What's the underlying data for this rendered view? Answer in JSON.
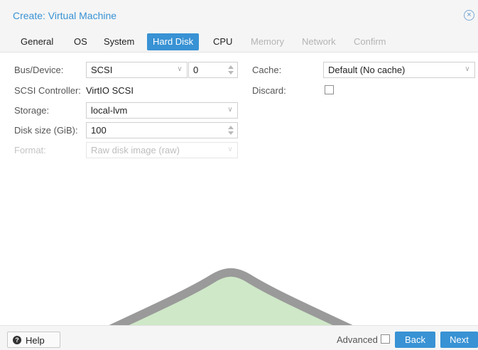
{
  "window": {
    "title": "Create: Virtual Machine",
    "close_glyph": "×"
  },
  "tabs": [
    {
      "label": "General",
      "state": "enabled"
    },
    {
      "label": "OS",
      "state": "enabled"
    },
    {
      "label": "System",
      "state": "enabled"
    },
    {
      "label": "Hard Disk",
      "state": "active"
    },
    {
      "label": "CPU",
      "state": "enabled"
    },
    {
      "label": "Memory",
      "state": "disabled"
    },
    {
      "label": "Network",
      "state": "disabled"
    },
    {
      "label": "Confirm",
      "state": "disabled"
    }
  ],
  "form": {
    "bus_device": {
      "label": "Bus/Device:",
      "bus": "SCSI",
      "device": "0"
    },
    "scsi_controller": {
      "label": "SCSI Controller:",
      "value": "VirtIO SCSI"
    },
    "storage": {
      "label": "Storage:",
      "value": "local-lvm"
    },
    "disk_size": {
      "label": "Disk size (GiB):",
      "value": "100"
    },
    "format": {
      "label": "Format:",
      "value": "Raw disk image (raw)"
    },
    "cache": {
      "label": "Cache:",
      "value": "Default (No cache)"
    },
    "discard": {
      "label": "Discard:",
      "checked": false
    }
  },
  "footer": {
    "help_label": "Help",
    "advanced_label": "Advanced",
    "advanced_checked": false,
    "back_label": "Back",
    "next_label": "Next"
  },
  "icons": {
    "close": "close-circle-icon",
    "help": "question-circle-icon",
    "dropdown": "chevron-down-icon",
    "spinner": "spinner-arrows-icon"
  },
  "colors": {
    "accent": "#3892d4",
    "disabled_text": "#b4b4b4",
    "watermark_fill": "#cfe8c8",
    "watermark_stroke": "#9a9a9a"
  }
}
